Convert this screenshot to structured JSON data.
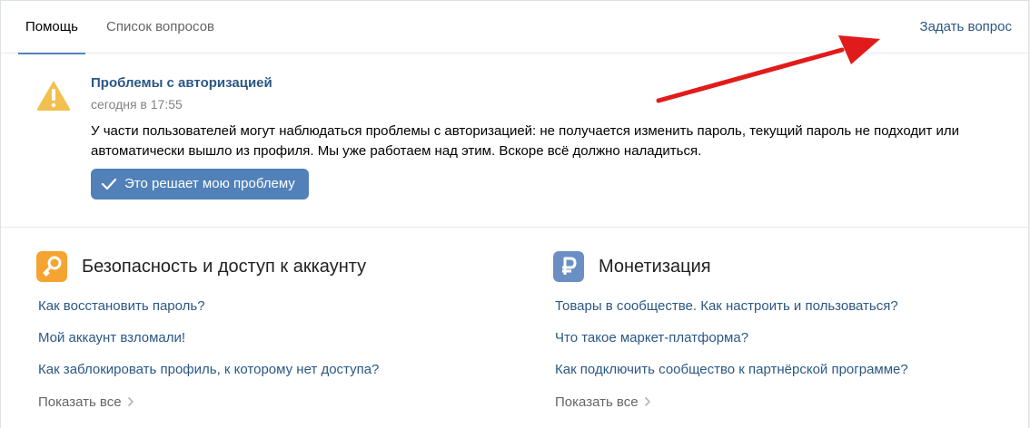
{
  "tabs": [
    {
      "label": "Помощь",
      "active": true
    },
    {
      "label": "Список вопросов",
      "active": false
    }
  ],
  "header": {
    "ask_label": "Задать вопрос"
  },
  "notice": {
    "icon": "warning-icon",
    "title": "Проблемы с авторизацией",
    "time": "сегодня в 17:55",
    "text": "У части пользователей могут наблюдаться проблемы с авторизацией: не получается изменить пароль, текущий пароль не подходит или автоматически вышло из профиля. Мы уже работаем над этим. Вскоре всё должно наладиться.",
    "button_label": "Это решает мою проблему"
  },
  "sections": [
    {
      "icon": "key-icon",
      "icon_color": "#f5a431",
      "title": "Безопасность и доступ к аккаунту",
      "questions": [
        "Как восстановить пароль?",
        "Мой аккаунт взломали!",
        "Как заблокировать профиль, к которому нет доступа?"
      ],
      "show_all": "Показать все"
    },
    {
      "icon": "ruble-icon",
      "icon_color": "#6b8fc4",
      "title": "Монетизация",
      "questions": [
        "Товары в сообществе. Как настроить и пользоваться?",
        "Что такое маркет-платформа?",
        "Как подключить сообщество к партнёрской программе?"
      ],
      "show_all": "Показать все"
    }
  ],
  "colors": {
    "accent": "#5181b8",
    "link": "#2a5885",
    "warning": "#f2c04e",
    "annotation_arrow": "#e11b1b"
  }
}
